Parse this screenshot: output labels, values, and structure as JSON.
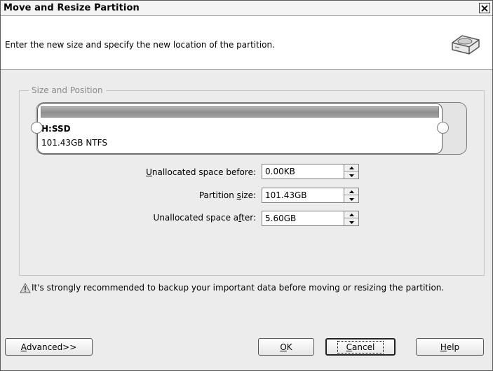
{
  "window": {
    "title": "Move and Resize Partition"
  },
  "header": {
    "description": "Enter the new size and specify the new location of the partition."
  },
  "group": {
    "legend": "Size and Position",
    "partition": {
      "name": "H:SSD",
      "info": "101.43GB NTFS"
    }
  },
  "fields": [
    {
      "label_pre": "",
      "label_key": "U",
      "label_post": "nallocated space before:",
      "value": "0.00KB"
    },
    {
      "label_pre": "Partition ",
      "label_key": "s",
      "label_post": "ize:",
      "value": "101.43GB"
    },
    {
      "label_pre": "Unallocated space a",
      "label_key": "f",
      "label_post": "ter:",
      "value": "5.60GB"
    }
  ],
  "warning": {
    "text": "It's strongly recommended to backup your important data before moving or resizing the partition."
  },
  "buttons": {
    "advanced": {
      "pre": "",
      "key": "A",
      "post": "dvanced>>"
    },
    "ok": {
      "pre": "",
      "key": "O",
      "post": "K"
    },
    "cancel": {
      "pre": "",
      "key": "C",
      "post": "ancel"
    },
    "help": {
      "pre": "",
      "key": "H",
      "post": "elp"
    }
  },
  "icons": {
    "close": "close-icon",
    "header": "disk-resize-icon",
    "warning": "warning-triangle-icon",
    "spin_up": "spin-up-arrow-icon",
    "spin_down": "spin-down-arrow-icon"
  },
  "colors": {
    "partition_bar": "#9a9a9a",
    "dialog_bg": "#ececec",
    "header_bg": "#ffffff"
  }
}
